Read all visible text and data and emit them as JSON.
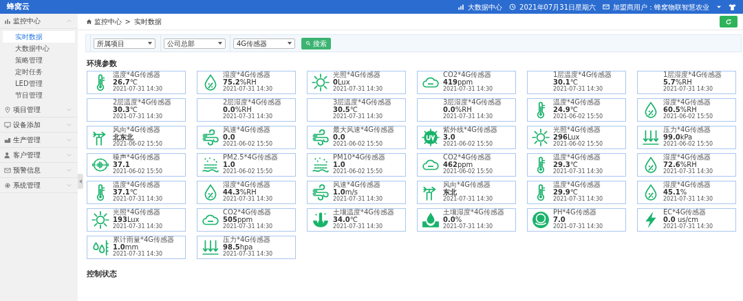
{
  "app_title": "蜂窝云",
  "header": {
    "links": [
      {
        "kind": "chart",
        "text": "大数据中心"
      },
      {
        "kind": "clock",
        "text": "2021年07月31日星期六"
      },
      {
        "kind": "mail",
        "text": "加盟商用户：蜂窝物联智慧农业"
      }
    ]
  },
  "sidebar": {
    "groups": [
      {
        "label": "监控中心",
        "kind": "monitor",
        "expanded": true,
        "children": [
          {
            "label": "实时数据",
            "selected": true
          },
          {
            "label": "大数据中心",
            "selected": false
          },
          {
            "label": "策略管理",
            "selected": false
          },
          {
            "label": "定时任务",
            "selected": false
          },
          {
            "label": "LED管理",
            "selected": false
          },
          {
            "label": "节目管理",
            "selected": false
          }
        ]
      },
      {
        "label": "项目管理",
        "kind": "pin",
        "expanded": false
      },
      {
        "label": "设备添加",
        "kind": "screen",
        "expanded": false
      },
      {
        "label": "生产管理",
        "kind": "factory",
        "expanded": false
      },
      {
        "label": "客户管理",
        "kind": "user",
        "expanded": false
      },
      {
        "label": "预警信息",
        "kind": "mail",
        "expanded": false
      },
      {
        "label": "系统管理",
        "kind": "gear",
        "expanded": false
      }
    ]
  },
  "breadcrumb": {
    "items": [
      "监控中心",
      "实时数据"
    ],
    "separator": ">"
  },
  "filters": {
    "selects": [
      "所属项目",
      "公司总部",
      "4G传感器"
    ],
    "search_button": "搜索"
  },
  "sections": [
    {
      "title": "环境参数",
      "sensors": [
        {
          "kind": "thermometer",
          "label": "温度*4G传感器",
          "value": "26.7",
          "unit": "℃",
          "time": "2021-07-31 14:30"
        },
        {
          "kind": "humidity",
          "label": "湿度*4G传感器",
          "value": "75.2",
          "unit": "%RH",
          "time": "2021-07-31 14:30"
        },
        {
          "kind": "sun",
          "label": "光照*4G传感器",
          "value": "0",
          "unit": "Lux",
          "time": "2021-07-31 14:30"
        },
        {
          "kind": "co2",
          "label": "CO2*4G传感器",
          "value": "419",
          "unit": "ppm",
          "time": "2021-07-31 14:30"
        },
        {
          "kind": "none",
          "label": "1层温度*4G传感器",
          "value": "30.1",
          "unit": "℃",
          "time": "2021-07-31 14:30"
        },
        {
          "kind": "none",
          "label": "1层湿度*4G传感器",
          "value": "5.7",
          "unit": "%RH",
          "time": "2021-07-31 14:30"
        },
        {
          "kind": "none",
          "label": "2层温度*4G传感器",
          "value": "30.3",
          "unit": "℃",
          "time": "2021-07-31 14:30"
        },
        {
          "kind": "none",
          "label": "2层湿度*4G传感器",
          "value": "0.0",
          "unit": "%RH",
          "time": "2021-07-31 14:30"
        },
        {
          "kind": "none",
          "label": "3层温度*4G传感器",
          "value": "30.5",
          "unit": "℃",
          "time": "2021-07-31 14:30"
        },
        {
          "kind": "none",
          "label": "3层湿度*4G传感器",
          "value": "0.0",
          "unit": "%RH",
          "time": "2021-07-31 14:30"
        },
        {
          "kind": "thermometer",
          "label": "温度*4G传感器",
          "value": "24.9",
          "unit": "℃",
          "time": "2021-06-02 15:50"
        },
        {
          "kind": "humidity",
          "label": "湿度*4G传感器",
          "value": "60.5",
          "unit": "%RH",
          "time": "2021-06-02 15:50"
        },
        {
          "kind": "wind_direction",
          "label": "风向*4G传感器",
          "value": "北东北",
          "time": "2021-06-02 15:50"
        },
        {
          "kind": "wind",
          "label": "风速*4G传感器",
          "value": "0.0",
          "time": "2021-06-02 15:50"
        },
        {
          "kind": "wind",
          "label": "最大风速*4G传感器",
          "value": "0.0",
          "time": "2021-06-02 15:50"
        },
        {
          "kind": "uv",
          "label": "紫外线*4G传感器",
          "value": "3.0",
          "time": "2021-06-02 15:50"
        },
        {
          "kind": "sun",
          "label": "光照*4G传感器",
          "value": "296",
          "unit": "Lux",
          "time": "2021-06-02 15:50"
        },
        {
          "kind": "pressure",
          "label": "压力*4G传感器",
          "value": "99.0",
          "unit": "kPa",
          "time": "2021-06-02 15:50"
        },
        {
          "kind": "noise",
          "label": "噪声*4G传感器",
          "value": "37.1",
          "time": "2021-06-02 15:50"
        },
        {
          "kind": "pm",
          "label": "PM2.5*4G传感器",
          "value": "1.0",
          "time": "2021-06-02 15:50"
        },
        {
          "kind": "pm",
          "label": "PM10*4G传感器",
          "value": "1.0",
          "time": "2021-06-02 15:50"
        },
        {
          "kind": "co2",
          "label": "CO2*4G传感器",
          "value": "462",
          "unit": "ppm",
          "time": "2021-06-02 15:50"
        },
        {
          "kind": "thermometer",
          "label": "温度*4G传感器",
          "value": "29.3",
          "unit": "℃",
          "time": "2021-07-31 14:30"
        },
        {
          "kind": "humidity",
          "label": "湿度*4G传感器",
          "value": "72.6",
          "unit": "%RH",
          "time": "2021-07-31 14:30"
        },
        {
          "kind": "thermometer",
          "label": "温度*4G传感器",
          "value": "37.1",
          "unit": "℃",
          "time": "2021-07-31 14:30"
        },
        {
          "kind": "humidity",
          "label": "湿度*4G传感器",
          "value": "44.3",
          "unit": "%RH",
          "time": "2021-07-31 14:30"
        },
        {
          "kind": "wind",
          "label": "风速*4G传感器",
          "value": "1.0",
          "unit": "m/s",
          "time": "2021-07-31 14:30"
        },
        {
          "kind": "wind_direction",
          "label": "风向*4G传感器",
          "value": "东北",
          "time": "2021-07-31 14:30"
        },
        {
          "kind": "thermometer",
          "label": "温度*4G传感器",
          "value": "29.9",
          "unit": "℃",
          "time": "2021-07-31 14:30"
        },
        {
          "kind": "humidity",
          "label": "湿度*4G传感器",
          "value": "45.1",
          "unit": "%",
          "time": "2021-07-31 14:30"
        },
        {
          "kind": "sun",
          "label": "光照*4G传感器",
          "value": "193",
          "unit": "Lux",
          "time": "2021-07-31 14:30"
        },
        {
          "kind": "co2",
          "label": "CO2*4G传感器",
          "value": "505",
          "unit": "ppm",
          "time": "2021-07-31 14:30"
        },
        {
          "kind": "soil_temp",
          "label": "土壤温度*4G传感器",
          "value": "34.0",
          "unit": "℃",
          "time": "2021-07-31 14:30"
        },
        {
          "kind": "soil_moisture",
          "label": "土壤湿度*4G传感器",
          "value": "0.0",
          "unit": "%",
          "time": "2021-07-31 14:30"
        },
        {
          "kind": "ph",
          "label": "PH*4G传感器",
          "value": "7.0",
          "time": "2021-07-31 14:30"
        },
        {
          "kind": "ec",
          "label": "EC*4G传感器",
          "value": "0.0",
          "unit": " us/cm",
          "time": "2021-07-31 14:30"
        },
        {
          "kind": "rain",
          "label": "累计雨量*4G传感器",
          "value": "1.0",
          "unit": "mm",
          "time": "2021-07-31 14:30"
        },
        {
          "kind": "pressure",
          "label": "压力*4G传感器",
          "value": "98.5",
          "unit": "hpa",
          "time": "2021-07-31 14:30"
        }
      ]
    },
    {
      "title": "控制状态"
    }
  ]
}
